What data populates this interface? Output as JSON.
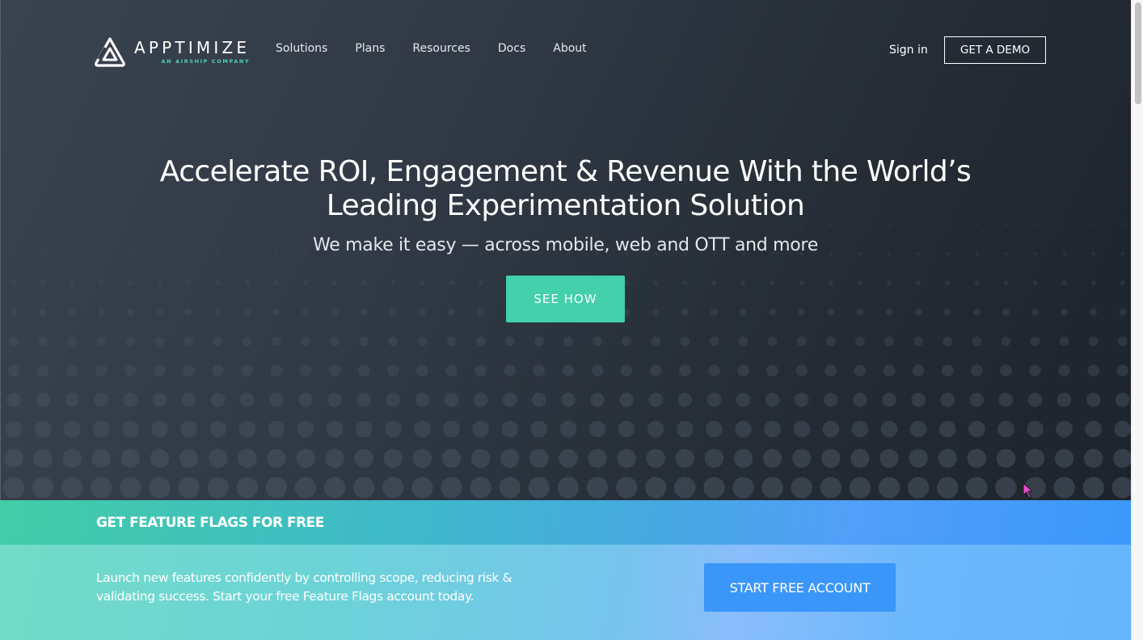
{
  "brand": {
    "name": "APPTIMIZE",
    "tagline": "AN AIRSHIP COMPANY",
    "logo_icon": "apptimize-triangle-logo",
    "accent_color": "#4fd1b2"
  },
  "nav": {
    "links": [
      {
        "label": "Solutions"
      },
      {
        "label": "Plans"
      },
      {
        "label": "Resources"
      },
      {
        "label": "Docs"
      },
      {
        "label": "About"
      }
    ],
    "sign_in_label": "Sign in",
    "demo_button_label": "GET A DEMO"
  },
  "hero": {
    "headline_line1": "Accelerate ROI, Engagement & Revenue With the World’s",
    "headline_line2": "Leading Experimentation Solution",
    "subheadline": "We make it easy — across mobile, web and OTT and more",
    "cta_label": "SEE HOW",
    "cta_color": "#43d0aa",
    "background_color": "#2a323c",
    "decoration": "dot-grid-pattern"
  },
  "feature_flags_band": {
    "title": "GET FEATURE FLAGS FOR FREE",
    "body": "Launch new features confidently by controlling scope, reducing risk & validating success. Start your free Feature Flags account today.",
    "cta_label": "START FREE ACCOUNT",
    "cta_color": "#3b96f9",
    "gradient_start": "#43cda7",
    "gradient_end": "#3b98fb"
  },
  "cursor": {
    "icon": "mouse-pointer-icon",
    "color": "#e84fd1"
  }
}
